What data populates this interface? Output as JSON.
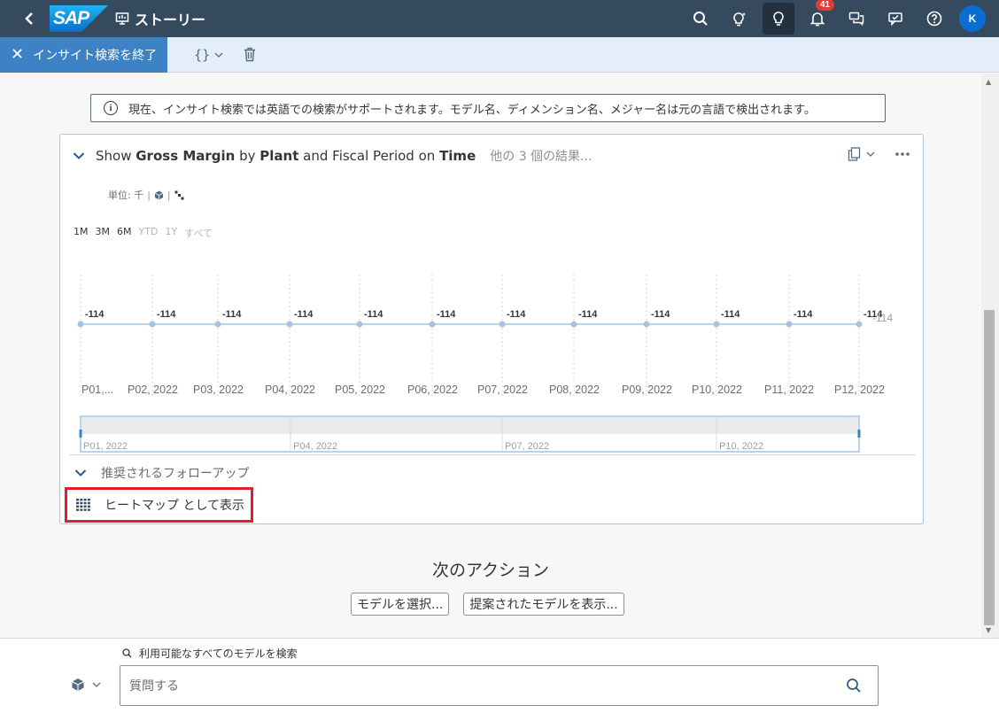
{
  "shell": {
    "logo": "SAP",
    "title": "ストーリー",
    "notification_count": "41",
    "avatar_initial": "K"
  },
  "toolbar": {
    "exit_label": "インサイト検索を終了",
    "braces_label": "{}"
  },
  "notice": {
    "text": "現在、インサイト検索では英語での検索がサポートされます。モデル名、ディメンション名、メジャー名は元の言語で検出されます。"
  },
  "card": {
    "title_parts": [
      {
        "text": "Show ",
        "bold": false
      },
      {
        "text": "Gross Margin",
        "bold": true
      },
      {
        "text": " by ",
        "bold": false
      },
      {
        "text": "Plant",
        "bold": true
      },
      {
        "text": " and Fiscal Period on ",
        "bold": false
      },
      {
        "text": "Time",
        "bold": true
      }
    ],
    "more_results": "他の 3 個の結果...",
    "units_label": "単位: 千",
    "range_buttons": [
      {
        "label": "1M",
        "enabled": true
      },
      {
        "label": "3M",
        "enabled": true
      },
      {
        "label": "6M",
        "enabled": true
      },
      {
        "label": "YTD",
        "enabled": false
      },
      {
        "label": "1Y",
        "enabled": false
      },
      {
        "label": "すべて",
        "enabled": false
      }
    ],
    "followup_label": "推奨されるフォローアップ",
    "heatmap_label": "ヒートマップ として表示"
  },
  "chart_data": {
    "type": "line",
    "categories": [
      "P01,...",
      "P02, 2022",
      "P03, 2022",
      "P04, 2022",
      "P05, 2022",
      "P06, 2022",
      "P07, 2022",
      "P08, 2022",
      "P09, 2022",
      "P10, 2022",
      "P11, 2022",
      "P12, 2022"
    ],
    "values": [
      -114,
      -114,
      -114,
      -114,
      -114,
      -114,
      -114,
      -114,
      -114,
      -114,
      -114,
      -114
    ],
    "last_value_label": "-114",
    "navigator_labels": [
      "P01, 2022",
      "P04, 2022",
      "P07, 2022",
      "P10, 2022"
    ],
    "line_color": "#a4c3e4"
  },
  "next": {
    "title": "次のアクション",
    "select_model": "モデルを選択...",
    "show_suggested": "提案されたモデルを表示..."
  },
  "search": {
    "hint": "利用可能なすべてのモデルを検索",
    "placeholder": "質問する"
  },
  "colors": {
    "shell": "#354a5f",
    "toolbar": "#e4eef8",
    "exit_button": "#3e82c6",
    "highlight": "#e21d2b"
  }
}
